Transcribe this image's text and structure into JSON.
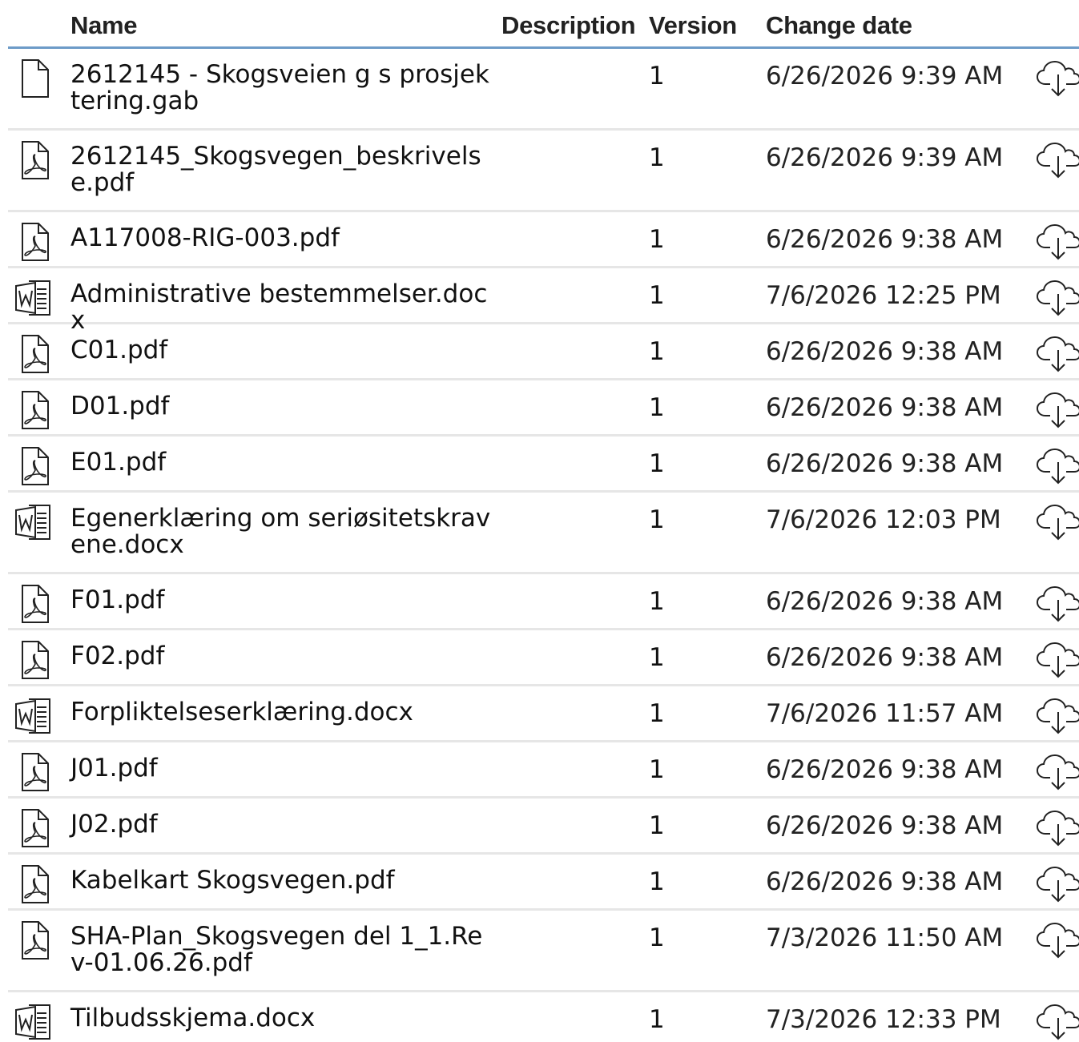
{
  "header": {
    "name": "Name",
    "description": "Description",
    "version": "Version",
    "change_date": "Change date"
  },
  "files": [
    {
      "icon": "file-icon",
      "name": "2612145 - Skogsveien g s prosjektering.gab",
      "description": "",
      "version": "1",
      "date": "6/26/2026 9:39 AM",
      "tall": true
    },
    {
      "icon": "pdf-icon",
      "name": "2612145_Skogsvegen_beskrivelse.pdf",
      "description": "",
      "version": "1",
      "date": "6/26/2026 9:39 AM",
      "tall": true
    },
    {
      "icon": "pdf-icon",
      "name": "A117008-RIG-003.pdf",
      "description": "",
      "version": "1",
      "date": "6/26/2026 9:38 AM",
      "tall": false
    },
    {
      "icon": "word-icon",
      "name": "Administrative bestemmelser.docx",
      "description": "",
      "version": "1",
      "date": "7/6/2026 12:25 PM",
      "tall": false
    },
    {
      "icon": "pdf-icon",
      "name": "C01.pdf",
      "description": "",
      "version": "1",
      "date": "6/26/2026 9:38 AM",
      "tall": false
    },
    {
      "icon": "pdf-icon",
      "name": "D01.pdf",
      "description": "",
      "version": "1",
      "date": "6/26/2026 9:38 AM",
      "tall": false
    },
    {
      "icon": "pdf-icon",
      "name": "E01.pdf",
      "description": "",
      "version": "1",
      "date": "6/26/2026 9:38 AM",
      "tall": false
    },
    {
      "icon": "word-icon",
      "name": "Egenerklæring om seriøsitetskravene.docx",
      "description": "",
      "version": "1",
      "date": "7/6/2026 12:03 PM",
      "tall": true
    },
    {
      "icon": "pdf-icon",
      "name": "F01.pdf",
      "description": "",
      "version": "1",
      "date": "6/26/2026 9:38 AM",
      "tall": false
    },
    {
      "icon": "pdf-icon",
      "name": "F02.pdf",
      "description": "",
      "version": "1",
      "date": "6/26/2026 9:38 AM",
      "tall": false
    },
    {
      "icon": "word-icon",
      "name": "Forpliktelseserklæring.docx",
      "description": "",
      "version": "1",
      "date": "7/6/2026 11:57 AM",
      "tall": false
    },
    {
      "icon": "pdf-icon",
      "name": "J01.pdf",
      "description": "",
      "version": "1",
      "date": "6/26/2026 9:38 AM",
      "tall": false
    },
    {
      "icon": "pdf-icon",
      "name": "J02.pdf",
      "description": "",
      "version": "1",
      "date": "6/26/2026 9:38 AM",
      "tall": false
    },
    {
      "icon": "pdf-icon",
      "name": "Kabelkart Skogsvegen.pdf",
      "description": "",
      "version": "1",
      "date": "6/26/2026 9:38 AM",
      "tall": false
    },
    {
      "icon": "pdf-icon",
      "name": "SHA-Plan_Skogsvegen del 1_1.Rev-01.06.26.pdf",
      "description": "",
      "version": "1",
      "date": "7/3/2026 11:50 AM",
      "tall": true
    },
    {
      "icon": "word-icon",
      "name": "Tilbudsskjema.docx",
      "description": "",
      "version": "1",
      "date": "7/3/2026 12:33 PM",
      "tall": false
    }
  ],
  "download_icon": "cloud-download-icon"
}
